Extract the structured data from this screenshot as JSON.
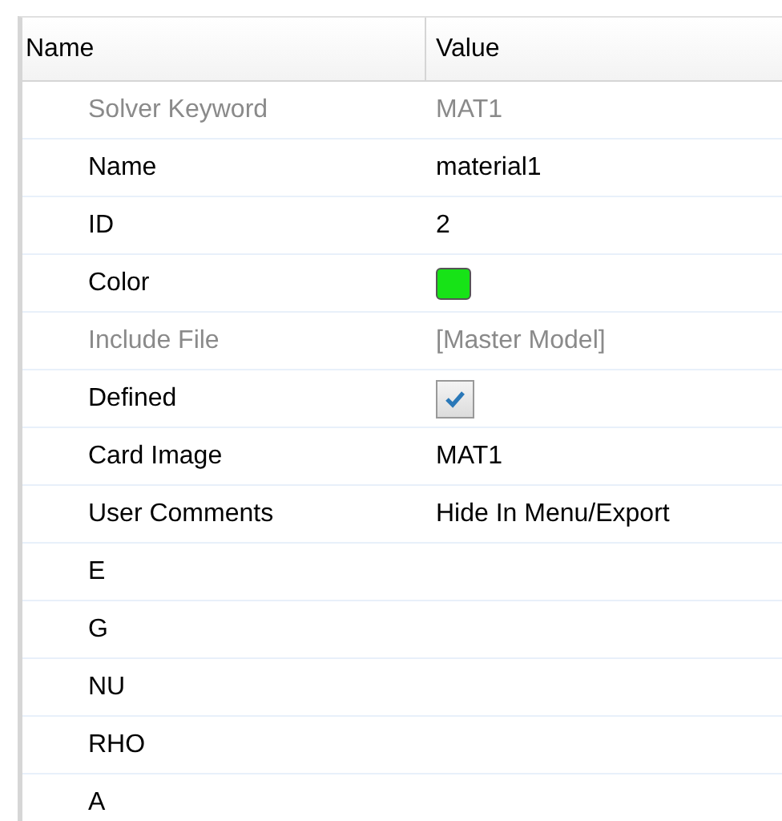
{
  "columns": [
    "Name",
    "Value"
  ],
  "rows": [
    {
      "kind": "text",
      "name": "Solver Keyword",
      "value": "MAT1",
      "disabled": true
    },
    {
      "kind": "text",
      "name": "Name",
      "value": "material1",
      "disabled": false
    },
    {
      "kind": "text",
      "name": "ID",
      "value": "2",
      "disabled": false
    },
    {
      "kind": "color",
      "name": "Color",
      "color": "#17e317",
      "disabled": false
    },
    {
      "kind": "text",
      "name": "Include File",
      "value": "[Master Model]",
      "disabled": true
    },
    {
      "kind": "checkbox",
      "name": "Defined",
      "checked": true,
      "disabled": false
    },
    {
      "kind": "text",
      "name": "Card Image",
      "value": "MAT1",
      "disabled": false
    },
    {
      "kind": "text",
      "name": "User Comments",
      "value": "Hide In Menu/Export",
      "disabled": false
    },
    {
      "kind": "text",
      "name": "E",
      "disabled": false
    },
    {
      "kind": "text",
      "name": "G",
      "disabled": false
    },
    {
      "kind": "text",
      "name": "NU",
      "disabled": false
    },
    {
      "kind": "text",
      "name": "RHO",
      "disabled": false
    },
    {
      "kind": "text",
      "name": "A",
      "disabled": false
    }
  ]
}
